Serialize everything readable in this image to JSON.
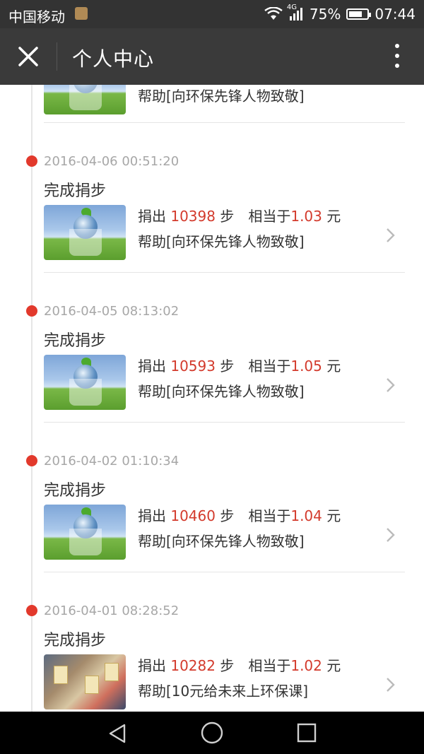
{
  "status_bar": {
    "carrier": "中国移动",
    "network": "4G",
    "battery": "75%",
    "battery_level": 0.75,
    "time": "07:44"
  },
  "title_bar": {
    "title": "个人中心"
  },
  "partial_record": {
    "help_text": "帮助[向环保先锋人物致敬]"
  },
  "records": [
    {
      "datetime": "2016-04-06 00:51:20",
      "action": "完成捐步",
      "donate_label": "捐出",
      "steps": "10398",
      "steps_unit": "步",
      "equiv_label": "相当于",
      "amount": "1.03",
      "currency": "元",
      "help_text": "帮助[向环保先锋人物致敬]"
    },
    {
      "datetime": "2016-04-05 08:13:02",
      "action": "完成捐步",
      "donate_label": "捐出",
      "steps": "10593",
      "steps_unit": "步",
      "equiv_label": "相当于",
      "amount": "1.05",
      "currency": "元",
      "help_text": "帮助[向环保先锋人物致敬]"
    },
    {
      "datetime": "2016-04-02 01:10:34",
      "action": "完成捐步",
      "donate_label": "捐出",
      "steps": "10460",
      "steps_unit": "步",
      "equiv_label": "相当于",
      "amount": "1.04",
      "currency": "元",
      "help_text": "帮助[向环保先锋人物致敬]"
    },
    {
      "datetime": "2016-04-01 08:28:52",
      "action": "完成捐步",
      "donate_label": "捐出",
      "steps": "10282",
      "steps_unit": "步",
      "equiv_label": "相当于",
      "amount": "1.02",
      "currency": "元",
      "help_text": "帮助[10元给未来上环保课]"
    }
  ],
  "colors": {
    "accent_red": "#e2392c",
    "title_bar_bg": "#3a3a3a",
    "status_bar_bg": "#333333"
  }
}
